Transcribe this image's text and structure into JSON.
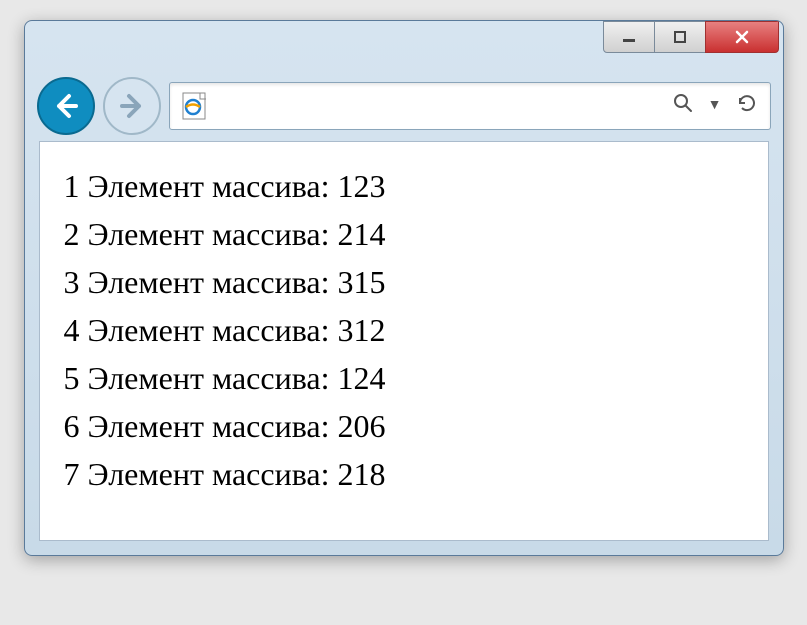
{
  "array_label": "Элемент массива:",
  "items": [
    {
      "index": "1",
      "value": "123"
    },
    {
      "index": "2",
      "value": "214"
    },
    {
      "index": "3",
      "value": "315"
    },
    {
      "index": "4",
      "value": "312"
    },
    {
      "index": "5",
      "value": "124"
    },
    {
      "index": "6",
      "value": "206"
    },
    {
      "index": "7",
      "value": "218"
    }
  ]
}
